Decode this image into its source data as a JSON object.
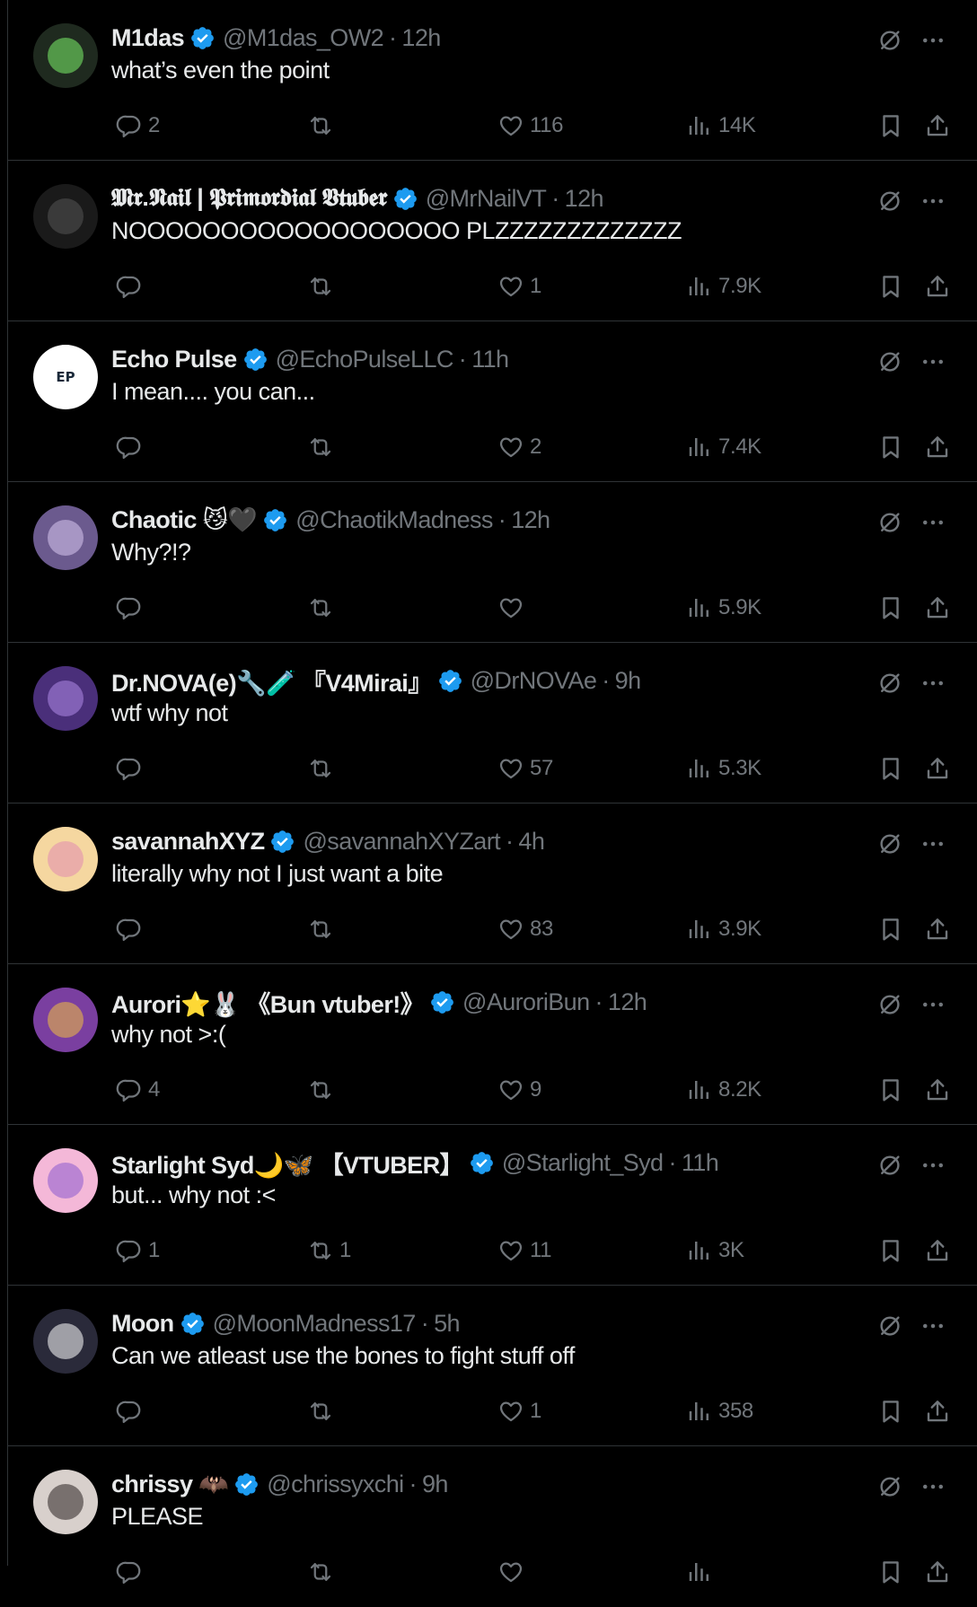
{
  "colors": {
    "background": "#000000",
    "text_primary": "#e7e9ea",
    "text_secondary": "#71767b",
    "divider": "#2f3336",
    "verified": "#1d9bf0"
  },
  "icons": {
    "verified": "verified-badge-icon",
    "grok": "grok-icon",
    "more": "more-icon",
    "reply": "reply-icon",
    "retweet": "retweet-icon",
    "like": "heart-icon",
    "views": "views-icon",
    "bookmark": "bookmark-icon",
    "share": "share-icon"
  },
  "tweets": [
    {
      "name": "M1das",
      "handle": "@M1das_OW2",
      "dot": "·",
      "time": "12h",
      "text": "what’s even the point",
      "replies": "2",
      "retweets": "",
      "likes": "116",
      "views": "14K",
      "avatar_bg": "#1f2a1f",
      "avatar_fg": "#7cf26a"
    },
    {
      "name": "𝕸𝖗.𝕹𝖆𝖎𝖑 | 𝕻𝖗𝖎𝖒𝖔𝖗𝖉𝖎𝖆𝖑 𝖁𝖙𝖚𝖇𝖊𝖗",
      "handle": "@MrNailVT",
      "dot": "·",
      "time": "12h",
      "text": "NOOOOOOOOOOOOOOOOOO PLZZZZZZZZZZZZZ",
      "replies": "",
      "retweets": "",
      "likes": "1",
      "views": "7.9K",
      "avatar_bg": "#1a1a1a",
      "avatar_fg": "#555555"
    },
    {
      "name": "Echo Pulse",
      "handle": "@EchoPulseLLC",
      "dot": "·",
      "time": "11h",
      "text": "I mean.... you can...",
      "replies": "",
      "retweets": "",
      "likes": "2",
      "views": "7.4K",
      "avatar_bg": "#ffffff",
      "avatar_fg": "#1b2a3a",
      "avatar_label": "EP"
    },
    {
      "name": "Chaotic 😼🖤",
      "handle": "@ChaotikMadness",
      "dot": "·",
      "time": "12h",
      "text": "Why?!?",
      "replies": "",
      "retweets": "",
      "likes": "",
      "views": "5.9K",
      "avatar_bg": "#6b5a8e",
      "avatar_fg": "#d9c9f0"
    },
    {
      "name": "Dr.NOVA(e)🔧🧪 『V4Mirai』",
      "handle": "@DrNOVAe",
      "dot": "·",
      "time": "9h",
      "text": "wtf why not",
      "replies": "",
      "retweets": "",
      "likes": "57",
      "views": "5.3K",
      "avatar_bg": "#4a2f7a",
      "avatar_fg": "#b08ae8"
    },
    {
      "name": "savannahXYZ",
      "handle": "@savannahXYZart",
      "dot": "·",
      "time": "4h",
      "text": "literally why not I just want a bite",
      "replies": "",
      "retweets": "",
      "likes": "83",
      "views": "3.9K",
      "avatar_bg": "#f5d7a0",
      "avatar_fg": "#e08ab0"
    },
    {
      "name": "Aurori⭐🐰 《Bun vtuber!》",
      "handle": "@AuroriBun",
      "dot": "·",
      "time": "12h",
      "text": "why not >:(",
      "replies": "4",
      "retweets": "",
      "likes": "9",
      "views": "8.2K",
      "avatar_bg": "#7a3fa0",
      "avatar_fg": "#f0c040"
    },
    {
      "name": "Starlight Syd🌙🦋 【VTUBER】",
      "handle": "@Starlight_Syd",
      "dot": "·",
      "time": "11h",
      "text": "but... why not :<",
      "replies": "1",
      "retweets": "1",
      "likes": "11",
      "views": "3K",
      "avatar_bg": "#f4b8d8",
      "avatar_fg": "#8a5ad0"
    },
    {
      "name": "Moon",
      "handle": "@MoonMadness17",
      "dot": "·",
      "time": "5h",
      "text": "Can we atleast use the bones to fight stuff off",
      "replies": "",
      "retweets": "",
      "likes": "1",
      "views": "358",
      "avatar_bg": "#2a2a3a",
      "avatar_fg": "#ffffff"
    },
    {
      "name": "chrissy 🦇",
      "handle": "@chrissyxchi",
      "dot": "·",
      "time": "9h",
      "text": "PLEASE",
      "replies": "",
      "retweets": "",
      "likes": "",
      "views": "",
      "avatar_bg": "#d8d0cc",
      "avatar_fg": "#2a2020"
    }
  ]
}
